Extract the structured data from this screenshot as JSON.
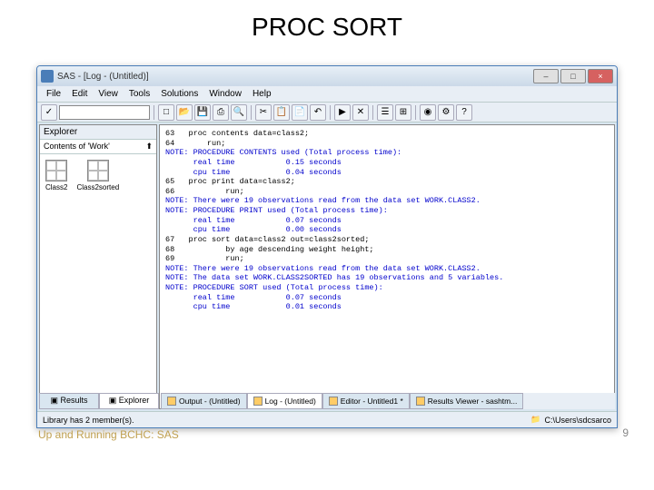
{
  "slide": {
    "title": "PROC SORT",
    "footer": "Up and Running BCHC: SAS",
    "page_number": "9"
  },
  "window": {
    "title": "SAS - [Log - (Untitled)]",
    "menu": [
      "File",
      "Edit",
      "View",
      "Tools",
      "Solutions",
      "Window",
      "Help"
    ],
    "explorer": {
      "title": "Explorer",
      "subtitle": "Contents of 'Work'",
      "items": [
        {
          "label": "Class2"
        },
        {
          "label": "Class2sorted"
        }
      ]
    },
    "log_lines": [
      {
        "num": "63",
        "text": "proc contents data=class2;",
        "cls": "code"
      },
      {
        "num": "64",
        "text": "    run;",
        "cls": "code"
      },
      {
        "num": "",
        "text": "",
        "cls": ""
      },
      {
        "num": "",
        "text": "NOTE: PROCEDURE CONTENTS used (Total process time):",
        "cls": "note"
      },
      {
        "num": "",
        "text": "      real time           0.15 seconds",
        "cls": "note"
      },
      {
        "num": "",
        "text": "      cpu time            0.04 seconds",
        "cls": "note"
      },
      {
        "num": "",
        "text": "",
        "cls": ""
      },
      {
        "num": "",
        "text": "",
        "cls": ""
      },
      {
        "num": "65",
        "text": "proc print data=class2;",
        "cls": "code"
      },
      {
        "num": "66",
        "text": "        run;",
        "cls": "code"
      },
      {
        "num": "",
        "text": "",
        "cls": ""
      },
      {
        "num": "",
        "text": "NOTE: There were 19 observations read from the data set WORK.CLASS2.",
        "cls": "note"
      },
      {
        "num": "",
        "text": "NOTE: PROCEDURE PRINT used (Total process time):",
        "cls": "note"
      },
      {
        "num": "",
        "text": "      real time           0.07 seconds",
        "cls": "note"
      },
      {
        "num": "",
        "text": "      cpu time            0.00 seconds",
        "cls": "note"
      },
      {
        "num": "",
        "text": "",
        "cls": ""
      },
      {
        "num": "",
        "text": "",
        "cls": ""
      },
      {
        "num": "67",
        "text": "proc sort data=class2 out=class2sorted;",
        "cls": "code"
      },
      {
        "num": "68",
        "text": "        by age descending weight height;",
        "cls": "code"
      },
      {
        "num": "69",
        "text": "        run;",
        "cls": "code"
      },
      {
        "num": "",
        "text": "",
        "cls": ""
      },
      {
        "num": "",
        "text": "NOTE: There were 19 observations read from the data set WORK.CLASS2.",
        "cls": "note"
      },
      {
        "num": "",
        "text": "NOTE: The data set WORK.CLASS2SORTED has 19 observations and 5 variables.",
        "cls": "note"
      },
      {
        "num": "",
        "text": "NOTE: PROCEDURE SORT used (Total process time):",
        "cls": "note"
      },
      {
        "num": "",
        "text": "      real time           0.07 seconds",
        "cls": "note"
      },
      {
        "num": "",
        "text": "      cpu time            0.01 seconds",
        "cls": "note"
      }
    ],
    "sidebar_tabs": [
      {
        "label": "Results",
        "active": false
      },
      {
        "label": "Explorer",
        "active": true
      }
    ],
    "bottom_tabs": [
      {
        "label": "Output - (Untitled)",
        "active": false
      },
      {
        "label": "Log - (Untitled)",
        "active": true
      },
      {
        "label": "Editor - Untitled1 *",
        "active": false
      },
      {
        "label": "Results Viewer - sashtm...",
        "active": false
      }
    ],
    "status_left": "Library has 2 member(s).",
    "status_right": "C:\\Users\\sdcsarco"
  }
}
